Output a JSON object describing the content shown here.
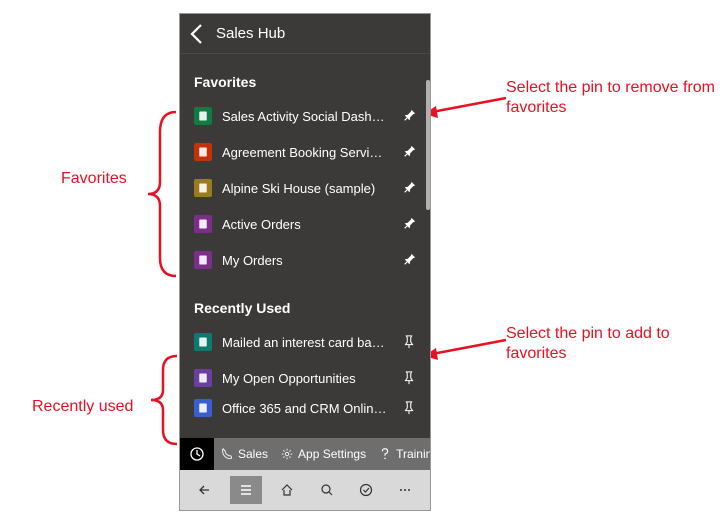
{
  "header": {
    "title": "Sales Hub"
  },
  "favorites": {
    "title": "Favorites",
    "items": [
      {
        "label": "Sales Activity Social Dashbo...",
        "iconColor": "#107c41",
        "iconType": "dashboard"
      },
      {
        "label": "Agreement Booking Service ...",
        "iconColor": "#c4320a",
        "iconType": "service"
      },
      {
        "label": "Alpine Ski House (sample)",
        "iconColor": "#9a7b1d",
        "iconType": "account"
      },
      {
        "label": "Active Orders",
        "iconColor": "#7c2e8a",
        "iconType": "order"
      },
      {
        "label": "My Orders",
        "iconColor": "#7c2e8a",
        "iconType": "order"
      }
    ]
  },
  "recentlyUsed": {
    "title": "Recently Used",
    "items": [
      {
        "label": "Mailed an interest card back...",
        "iconColor": "#0e7a6f",
        "iconType": "activity"
      },
      {
        "label": "My Open Opportunities",
        "iconColor": "#6b3fa0",
        "iconType": "opportunity"
      },
      {
        "label": "Office 365 and CRM Online...",
        "iconColor": "#3a5fcd",
        "iconType": "record"
      }
    ]
  },
  "commandBar": {
    "items": [
      {
        "label": "Sales",
        "icon": "phone"
      },
      {
        "label": "App Settings",
        "icon": "gear"
      },
      {
        "label": "Trainin",
        "icon": "question"
      }
    ]
  },
  "annotations": {
    "favorites": "Favorites",
    "recentlyUsed": "Recently used",
    "pinRemove": "Select the pin to remove from favorites",
    "pinAdd": "Select the pin to add to favorites"
  }
}
